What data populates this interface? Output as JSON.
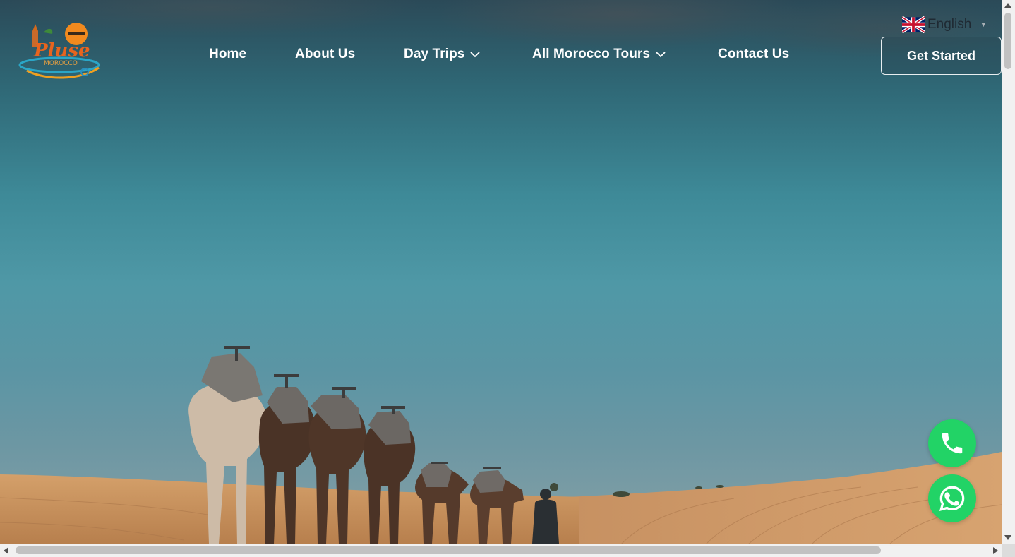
{
  "nav": {
    "items": [
      {
        "label": "Home",
        "has_dropdown": false
      },
      {
        "label": "About Us",
        "has_dropdown": false
      },
      {
        "label": "Day Trips",
        "has_dropdown": true
      },
      {
        "label": "All Morocco Tours",
        "has_dropdown": true
      },
      {
        "label": "Contact Us",
        "has_dropdown": false
      }
    ]
  },
  "language": {
    "label": "English",
    "flag_icon": "uk-flag-icon"
  },
  "cta": {
    "label": "Get Started"
  },
  "floating_buttons": [
    {
      "name": "phone-call-button",
      "icon": "phone-icon",
      "color": "#22d366"
    },
    {
      "name": "whatsapp-button",
      "icon": "whatsapp-icon",
      "color": "#22d366"
    }
  ],
  "colors": {
    "sky_top": "#2b4a58",
    "sky_mid": "#4f98a6",
    "sand": "#c9955e",
    "accent_green": "#22d366"
  }
}
